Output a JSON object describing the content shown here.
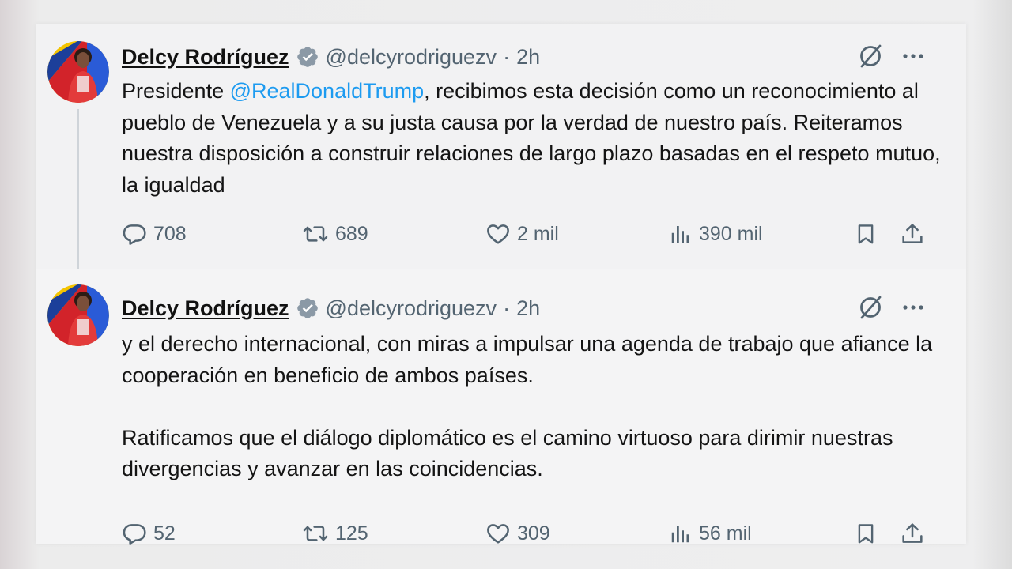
{
  "tweets": [
    {
      "author": {
        "name": "Delcy Rodríguez",
        "handle": "@delcyrodriguezv",
        "time": "2h",
        "verified": true
      },
      "text": {
        "prefix": "Presidente ",
        "mention": "@RealDonaldTrump",
        "rest": ", recibimos esta decisión como un reconocimiento al pueblo de Venezuela y a su justa causa por la verdad de nuestro país. Reiteramos nuestra disposición a construir relaciones de largo plazo basadas en el respeto mutuo, la igualdad"
      },
      "stats": {
        "replies": "708",
        "reposts": "689",
        "likes": "2 mil",
        "views": "390 mil"
      }
    },
    {
      "author": {
        "name": "Delcy Rodríguez",
        "handle": "@delcyrodriguezv",
        "time": "2h",
        "verified": true
      },
      "text": {
        "paragraph1": "y el derecho internacional, con miras a impulsar una agenda de trabajo que afiance la cooperación en beneficio de ambos países.",
        "paragraph2": "Ratificamos que el diálogo diplomático es el camino virtuoso para dirimir nuestras divergencias y avanzar en las coincidencias."
      },
      "stats": {
        "replies": "52",
        "reposts": "125",
        "likes": "309",
        "views": "56 mil"
      }
    }
  ],
  "separator": "·",
  "icons": {
    "verified": "verified-badge-icon",
    "grok": "grok-icon",
    "more": "more-options-icon",
    "reply": "reply-icon",
    "repost": "repost-icon",
    "like": "heart-icon",
    "views": "views-bar-chart-icon",
    "bookmark": "bookmark-icon",
    "share": "share-icon"
  },
  "colors": {
    "mention": "#1d9bf0",
    "secondary_text": "#536471",
    "primary_text": "#141414",
    "verified_badge": "#8b99a6"
  }
}
